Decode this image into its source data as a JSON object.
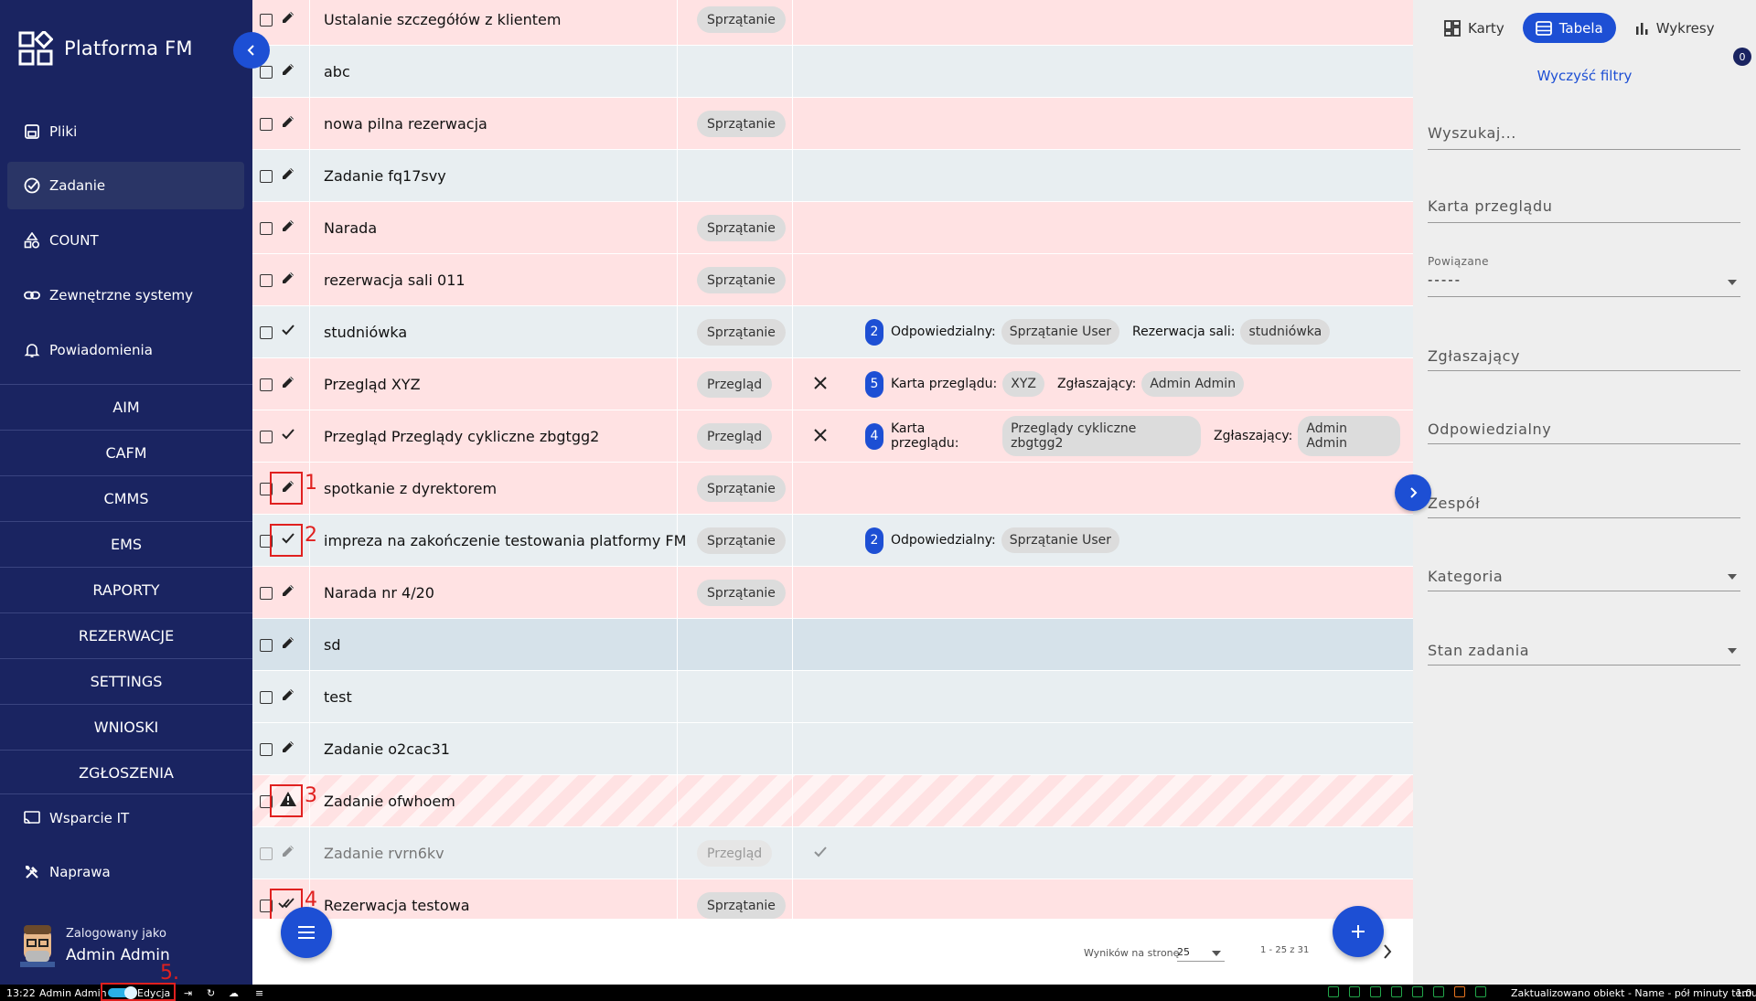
{
  "app": {
    "title": "Platforma FM"
  },
  "sidebar": {
    "items": [
      {
        "label": "Pliki",
        "icon": "save-icon"
      },
      {
        "label": "Zadanie",
        "icon": "check-circle-icon"
      },
      {
        "label": "COUNT",
        "icon": "shapes-icon"
      },
      {
        "label": "Zewnętrzne systemy",
        "icon": "link-icon"
      },
      {
        "label": "Powiadomienia",
        "icon": "bell-icon"
      }
    ],
    "sections": [
      "AIM",
      "CAFM",
      "CMMS",
      "EMS",
      "RAPORTY",
      "REZERWACJE",
      "SETTINGS",
      "WNIOSKI",
      "ZGŁOSZENIA"
    ],
    "bottom_items": [
      {
        "label": "Wsparcie IT",
        "icon": "cast-icon"
      },
      {
        "label": "Naprawa",
        "icon": "tools-icon"
      }
    ],
    "user": {
      "logged_as": "Zalogowany jako",
      "name": "Admin Admin"
    }
  },
  "table": {
    "rows": [
      {
        "name": "Ustalanie szczegółów z klientem",
        "category": "Sprzątanie",
        "action": "pencil-icon"
      },
      {
        "name": "abc",
        "category": "",
        "action": "pencil-icon"
      },
      {
        "name": "nowa pilna rezerwacja",
        "category": "Sprzątanie",
        "action": "pencil-icon"
      },
      {
        "name": "Zadanie fq17svy",
        "category": "",
        "action": "pencil-icon"
      },
      {
        "name": "Narada",
        "category": "Sprzątanie",
        "action": "pencil-icon"
      },
      {
        "name": "rezerwacja sali 011",
        "category": "Sprzątanie",
        "action": "pencil-icon"
      },
      {
        "name": "studniówka",
        "category": "Sprzątanie",
        "action": "check-icon",
        "count": "2",
        "details": [
          {
            "label": "Odpowiedzialny:",
            "value": "Sprzątanie User"
          },
          {
            "label": "Rezerwacja sali:",
            "value": "studniówka"
          }
        ]
      },
      {
        "name": "Przegląd XYZ",
        "category": "Przegląd",
        "action": "pencil-icon",
        "mark": "close-icon",
        "count": "5",
        "details": [
          {
            "label": "Karta przeglądu:",
            "value": "XYZ"
          },
          {
            "label": "Zgłaszający:",
            "value": "Admin Admin"
          }
        ]
      },
      {
        "name": "Przegląd Przeglądy cykliczne zbgtgg2",
        "category": "Przegląd",
        "action": "check-icon",
        "mark": "close-icon",
        "count": "4",
        "details": [
          {
            "label": "Karta przeglądu:",
            "value": "Przeglądy cykliczne zbgtgg2"
          },
          {
            "label": "Zgłaszający:",
            "value": "Admin Admin"
          }
        ]
      },
      {
        "name": "spotkanie z dyrektorem",
        "category": "Sprzątanie",
        "action": "pencil-icon",
        "annotation": "1"
      },
      {
        "name": "impreza na zakończenie testowania platformy FM",
        "category": "Sprzątanie",
        "action": "check-icon",
        "annotation": "2",
        "count": "2",
        "details": [
          {
            "label": "Odpowiedzialny:",
            "value": "Sprzątanie User"
          }
        ]
      },
      {
        "name": "Narada nr 4/20",
        "category": "Sprzątanie",
        "action": "pencil-icon"
      },
      {
        "name": "sd",
        "category": "",
        "action": "pencil-icon"
      },
      {
        "name": "test",
        "category": "",
        "action": "pencil-icon"
      },
      {
        "name": "Zadanie o2cac31",
        "category": "",
        "action": "pencil-icon"
      },
      {
        "name": "Zadanie ofwhoem",
        "category": "",
        "action": "warning-icon",
        "annotation": "3"
      },
      {
        "name": "Zadanie rvrn6kv",
        "category": "Przegląd",
        "action": "pencil-icon",
        "mark": "check-icon"
      },
      {
        "name": "Rezerwacja testowa",
        "category": "Sprzątanie",
        "action": "double-check-icon",
        "annotation": "4"
      }
    ]
  },
  "pagination": {
    "per_page_label": "Wyników na stronę",
    "per_page": "25",
    "range": "1 - 25 z 31"
  },
  "right_panel": {
    "views": [
      {
        "label": "Karty",
        "icon": "cards-icon"
      },
      {
        "label": "Tabela",
        "icon": "table-icon"
      },
      {
        "label": "Wykresy",
        "icon": "bar-chart-icon"
      }
    ],
    "badge": "0",
    "clear_filters": "Wyczyść filtry",
    "search_placeholder": "Wyszukaj...",
    "filters": {
      "karta": "Karta przeglądu",
      "powiazane_label": "Powiązane",
      "powiazane_value": "-----",
      "zglaszajacy": "Zgłaszający",
      "odpowiedzialny": "Odpowiedzialny",
      "zespol": "Zespół",
      "kategoria": "Kategoria",
      "stan": "Stan zadania"
    }
  },
  "status_bar": {
    "time": "13:22",
    "user": "Admin Admin",
    "mode": "Edycja",
    "annotation": "5.",
    "message": "Zaktualizowano obiekt - Name - pół minuty temu",
    "version": "1.0"
  },
  "colors": {
    "sidebar": "#1a2461",
    "accent": "#1d4fd4",
    "row_pink": "#ffe2e3",
    "row_grey": "#e8eef1",
    "annotation": "#e0201f"
  }
}
